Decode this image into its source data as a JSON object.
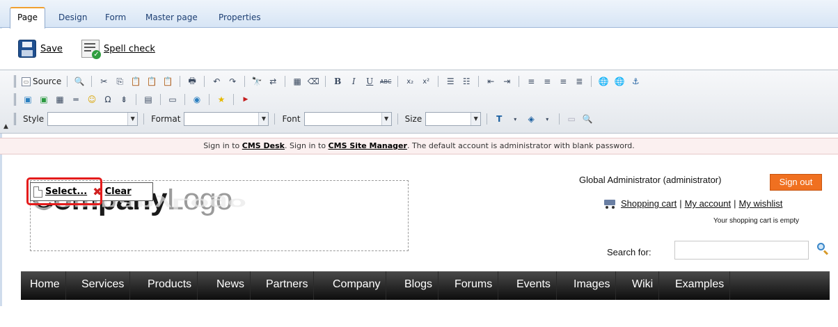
{
  "tabs": [
    {
      "label": "Page",
      "active": true
    },
    {
      "label": "Design",
      "active": false
    },
    {
      "label": "Form",
      "active": false
    },
    {
      "label": "Master page",
      "active": false
    },
    {
      "label": "Properties",
      "active": false
    }
  ],
  "actions": {
    "save_label": "Save",
    "spell_check_label": "Spell check"
  },
  "editor_toolbar": {
    "source_label": "Source",
    "style_label": "Style",
    "format_label": "Format",
    "font_label": "Font",
    "size_label": "Size",
    "bold": "B",
    "italic": "I",
    "underline": "U",
    "strike": "ABC",
    "subscript": "x₂",
    "superscript": "x²"
  },
  "signin_bar": {
    "part1": "Sign in to ",
    "cms_desk": "CMS Desk",
    "part2": ". Sign in to ",
    "site_manager": "CMS Site Manager",
    "part3": ". The default account is administrator with blank password."
  },
  "logo": {
    "select_label": "Select...",
    "clear_label": "Clear",
    "logo_company": "Company",
    "logo_logo": "Logo"
  },
  "user": {
    "name": "Global Administrator (administrator)",
    "signout_label": "Sign out"
  },
  "cart": {
    "shopping_cart": "Shopping cart",
    "sep": " | ",
    "my_account": "My account",
    "my_wishlist": "My wishlist",
    "empty_text": "Your shopping cart is empty"
  },
  "search": {
    "label": "Search for:",
    "value": ""
  },
  "nav": [
    "Home",
    "Services",
    "Products",
    "News",
    "Partners",
    "Company",
    "Blogs",
    "Forums",
    "Events",
    "Images",
    "Wiki",
    "Examples"
  ],
  "colors": {
    "accent_orange": "#f07020",
    "highlight_red": "#e41c1c",
    "nav_dark": "#0d0d0d"
  }
}
